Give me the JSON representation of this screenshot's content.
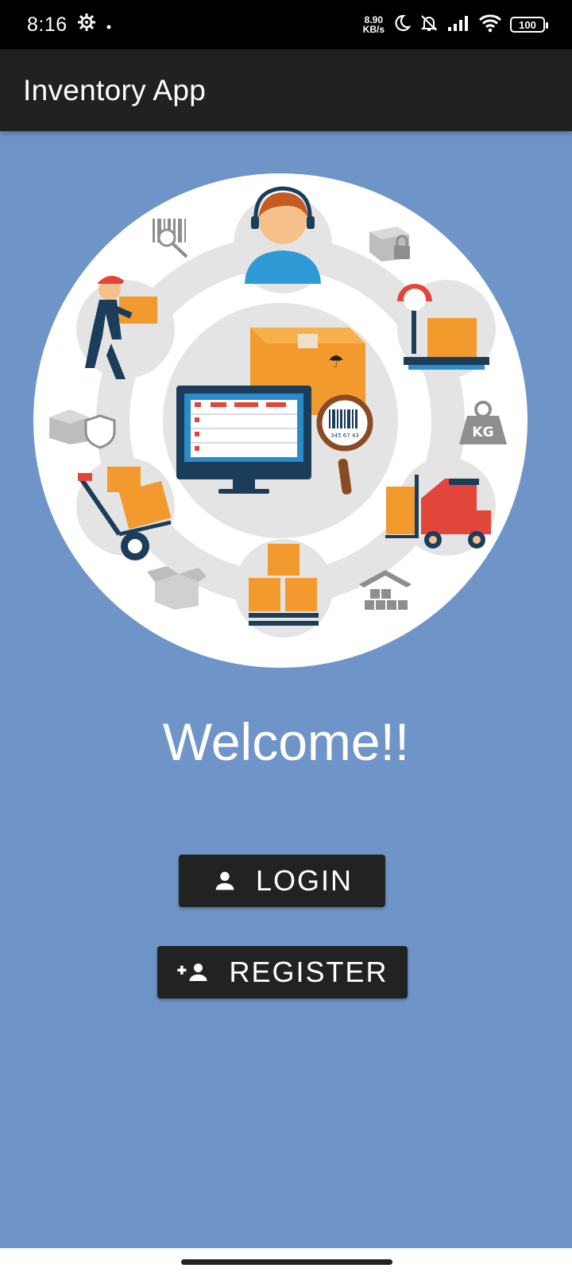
{
  "status_bar": {
    "time": "8:16",
    "net_speed_value": "8.90",
    "net_speed_unit": "KB/s",
    "battery": "100"
  },
  "app_bar": {
    "title": "Inventory App"
  },
  "main": {
    "welcome": "Welcome!!",
    "login_label": "LOGIN",
    "register_label": "REGISTER"
  },
  "illustration": {
    "kg_label": "KG",
    "barcode_number": "345 67 43"
  },
  "colors": {
    "background": "#6f95c8",
    "app_bar": "#212121",
    "button": "#222222",
    "accent_orange": "#f39a2f"
  }
}
